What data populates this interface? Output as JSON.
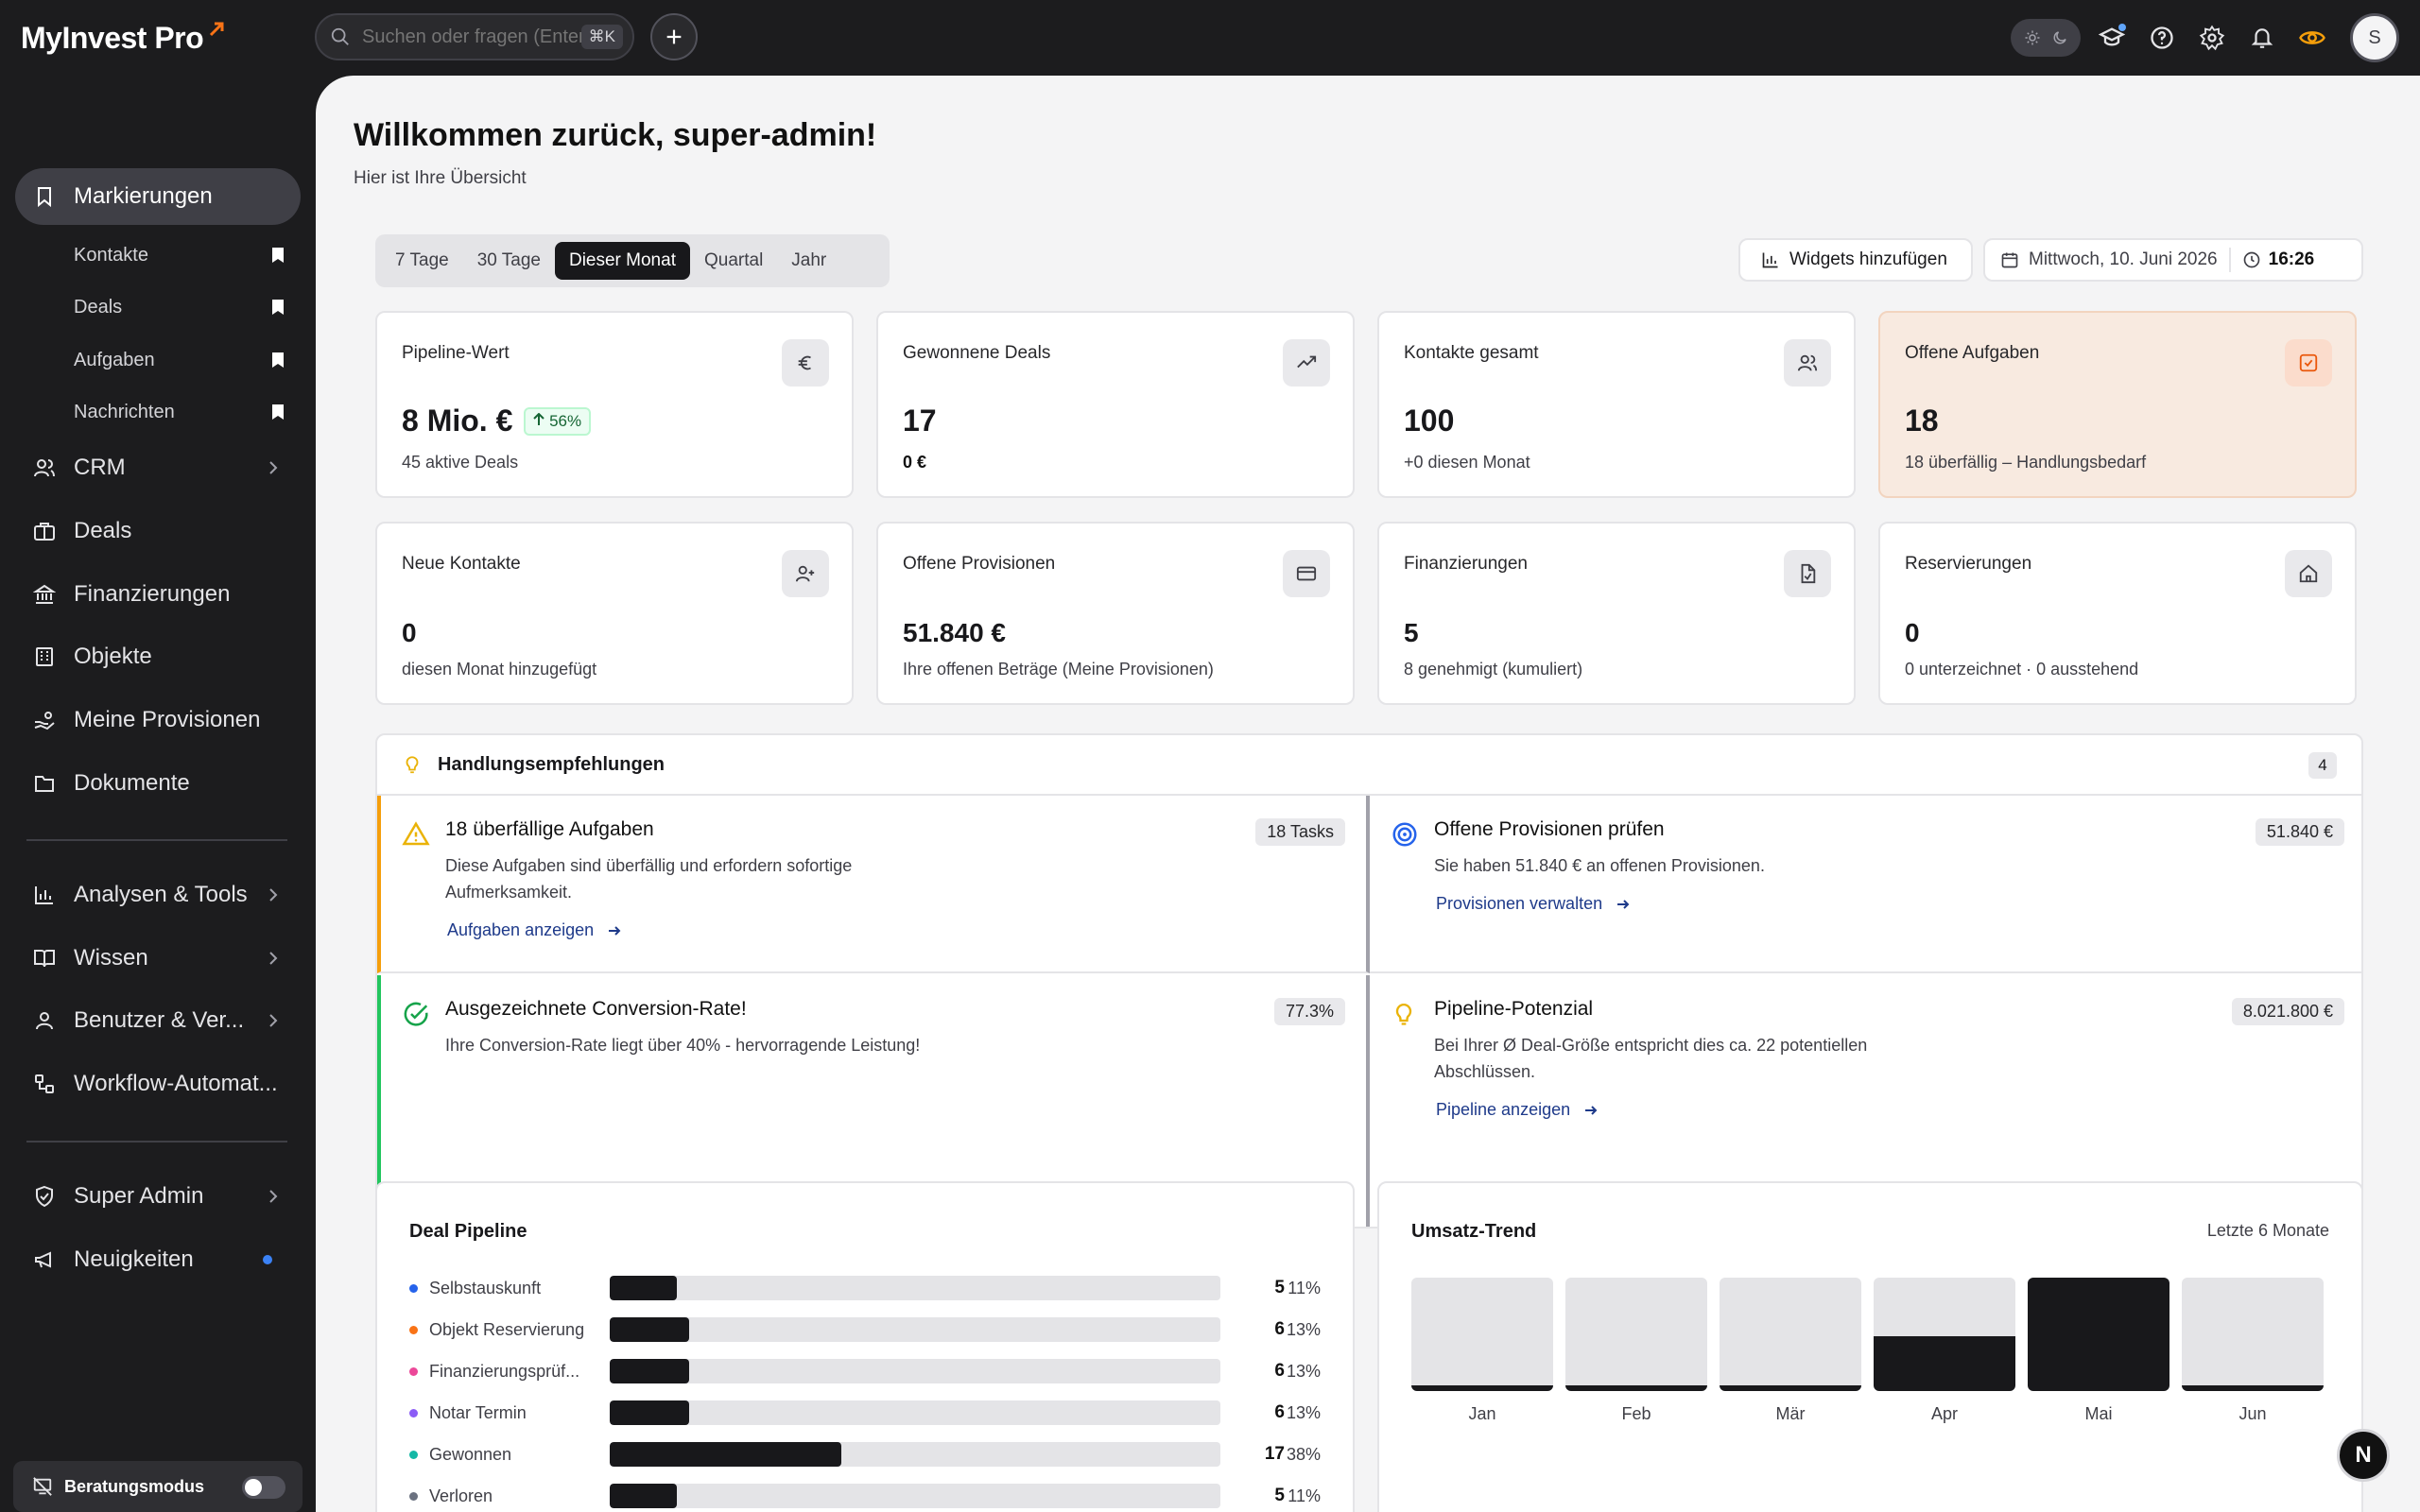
{
  "app": {
    "name": "MyInvest Pro"
  },
  "topbar": {
    "search_placeholder": "Suchen oder fragen (Enter)",
    "shortcut": "⌘K",
    "avatar_initial": "S"
  },
  "sidebar": {
    "markierungen": "Markierungen",
    "bookmarks": [
      "Kontakte",
      "Deals",
      "Aufgaben",
      "Nachrichten"
    ],
    "items": {
      "crm": "CRM",
      "deals": "Deals",
      "finanzierungen": "Finanzierungen",
      "objekte": "Objekte",
      "provisionen": "Meine Provisionen",
      "dokumente": "Dokumente",
      "analysen": "Analysen & Tools",
      "wissen": "Wissen",
      "benutzer": "Benutzer & Ver...",
      "workflow": "Workflow-Automat...",
      "superadmin": "Super Admin",
      "neuigkeiten": "Neuigkeiten"
    },
    "beratungsmodus": "Beratungsmodus"
  },
  "main": {
    "title": "Willkommen zurück, super-admin!",
    "subtitle": "Hier ist Ihre Übersicht",
    "periods": [
      "7 Tage",
      "30 Tage",
      "Dieser Monat",
      "Quartal",
      "Jahr"
    ],
    "widgets_button": "Widgets hinzufügen",
    "date": "Mittwoch, 10. Juni 2026",
    "time": "16:26"
  },
  "cards": {
    "pipeline": {
      "title": "Pipeline-Wert",
      "value": "8 Mio. €",
      "badge": "56%",
      "sub": "45 aktive Deals"
    },
    "won": {
      "title": "Gewonnene Deals",
      "value": "17",
      "sub": "0 €"
    },
    "contacts": {
      "title": "Kontakte gesamt",
      "value": "100",
      "sub": "+0 diesen Monat"
    },
    "tasks": {
      "title": "Offene Aufgaben",
      "value": "18",
      "sub": "18 überfällig – Handlungsbedarf"
    },
    "new_contacts": {
      "title": "Neue Kontakte",
      "value": "0",
      "sub": "diesen Monat hinzugefügt"
    },
    "commissions": {
      "title": "Offene Provisionen",
      "value": "51.840 €",
      "sub": "Ihre offenen Beträge (Meine Provisionen)"
    },
    "financing": {
      "title": "Finanzierungen",
      "value": "5",
      "sub": "8 genehmigt (kumuliert)"
    },
    "reservations": {
      "title": "Reservierungen",
      "value": "0",
      "sub": "0 unterzeichnet · 0 ausstehend"
    }
  },
  "recommendations": {
    "title": "Handlungsempfehlungen",
    "count": "4",
    "overdue": {
      "title": "18 überfällige Aufgaben",
      "desc": "Diese Aufgaben sind überfällig und erfordern sofortige Aufmerksamkeit.",
      "badge": "18 Tasks",
      "link": "Aufgaben anzeigen"
    },
    "provisions": {
      "title": "Offene Provisionen prüfen",
      "desc": "Sie haben 51.840 € an offenen Provisionen.",
      "badge": "51.840 €",
      "link": "Provisionen verwalten"
    },
    "conversion": {
      "title": "Ausgezeichnete Conversion-Rate!",
      "desc": "Ihre Conversion-Rate liegt über 40% - hervorragende Leistung!",
      "badge": "77.3%"
    },
    "potential": {
      "title": "Pipeline-Potenzial",
      "desc": "Bei Ihrer Ø Deal-Größe entspricht dies ca. 22 potentiellen Abschlüssen.",
      "badge": "8.021.800 €",
      "link": "Pipeline anzeigen"
    }
  },
  "pipeline": {
    "title": "Deal Pipeline",
    "stages": [
      {
        "label": "Selbstauskunft",
        "color": "#2563eb",
        "count": "5",
        "percent": "11%",
        "share": 0.11
      },
      {
        "label": "Objekt Reservierung",
        "color": "#f97316",
        "count": "6",
        "percent": "13%",
        "share": 0.13
      },
      {
        "label": "Finanzierungsprüf...",
        "color": "#ec4899",
        "count": "6",
        "percent": "13%",
        "share": 0.13
      },
      {
        "label": "Notar Termin",
        "color": "#8b5cf6",
        "count": "6",
        "percent": "13%",
        "share": 0.13
      },
      {
        "label": "Gewonnen",
        "color": "#14b8a6",
        "count": "17",
        "percent": "38%",
        "share": 0.38
      },
      {
        "label": "Verloren",
        "color": "#6b7280",
        "count": "5",
        "percent": "11%",
        "share": 0.11
      }
    ]
  },
  "trend": {
    "title": "Umsatz-Trend",
    "range": "Letzte 6 Monate",
    "months": [
      {
        "label": "Jan",
        "level": 0.05
      },
      {
        "label": "Feb",
        "level": 0.05
      },
      {
        "label": "Mär",
        "level": 0.05
      },
      {
        "label": "Apr",
        "level": 0.48
      },
      {
        "label": "Mai",
        "level": 1.0
      },
      {
        "label": "Jun",
        "level": 0.05
      }
    ]
  },
  "fab": {
    "label": "N"
  }
}
